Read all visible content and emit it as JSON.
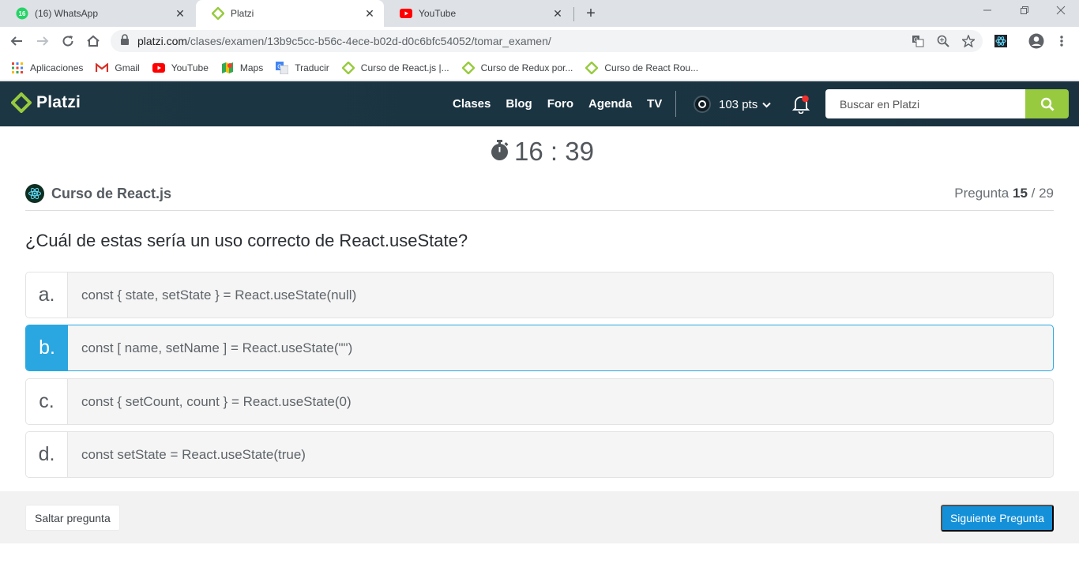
{
  "browser": {
    "tabs": [
      {
        "title": "(16) WhatsApp",
        "badge": "16"
      },
      {
        "title": "Platzi"
      },
      {
        "title": "YouTube"
      }
    ],
    "close_glyph": "✕",
    "new_tab_glyph": "+",
    "url_host": "platzi.com",
    "url_path": "/clases/examen/13b9c5cc-b56c-4ece-b02d-d0c6bfc54052/tomar_examen/",
    "bookmarks": [
      {
        "label": "Aplicaciones"
      },
      {
        "label": "Gmail"
      },
      {
        "label": "YouTube"
      },
      {
        "label": "Maps"
      },
      {
        "label": "Traducir"
      },
      {
        "label": "Curso de React.js |..."
      },
      {
        "label": "Curso de Redux por..."
      },
      {
        "label": "Curso de React Rou..."
      }
    ]
  },
  "header": {
    "logo": "Platzi",
    "nav": [
      "Clases",
      "Blog",
      "Foro",
      "Agenda",
      "TV"
    ],
    "points": "103 pts",
    "search_placeholder": "Buscar en Platzi"
  },
  "exam": {
    "timer": "16 : 39",
    "course": "Curso de React.js",
    "question_label": "Pregunta",
    "question_current": "15",
    "question_total": "/ 29",
    "question": "¿Cuál de estas sería un uso correcto de React.useState?",
    "options": [
      {
        "letter": "a.",
        "text": "const { state, setState } = React.useState(null)"
      },
      {
        "letter": "b.",
        "text": "const [ name, setName ] = React.useState(\"\")"
      },
      {
        "letter": "c.",
        "text": "const { setCount, count } = React.useState(0)"
      },
      {
        "letter": "d.",
        "text": "const setState = React.useState(true)"
      }
    ],
    "selected_option": "b.",
    "skip_label": "Saltar pregunta",
    "next_label": "Siguiente Pregunta"
  },
  "colors": {
    "accent_green": "#98ca3f",
    "selected_blue": "#2aa6e0",
    "button_blue": "#1490d9",
    "header_bg": "#1c3643"
  }
}
